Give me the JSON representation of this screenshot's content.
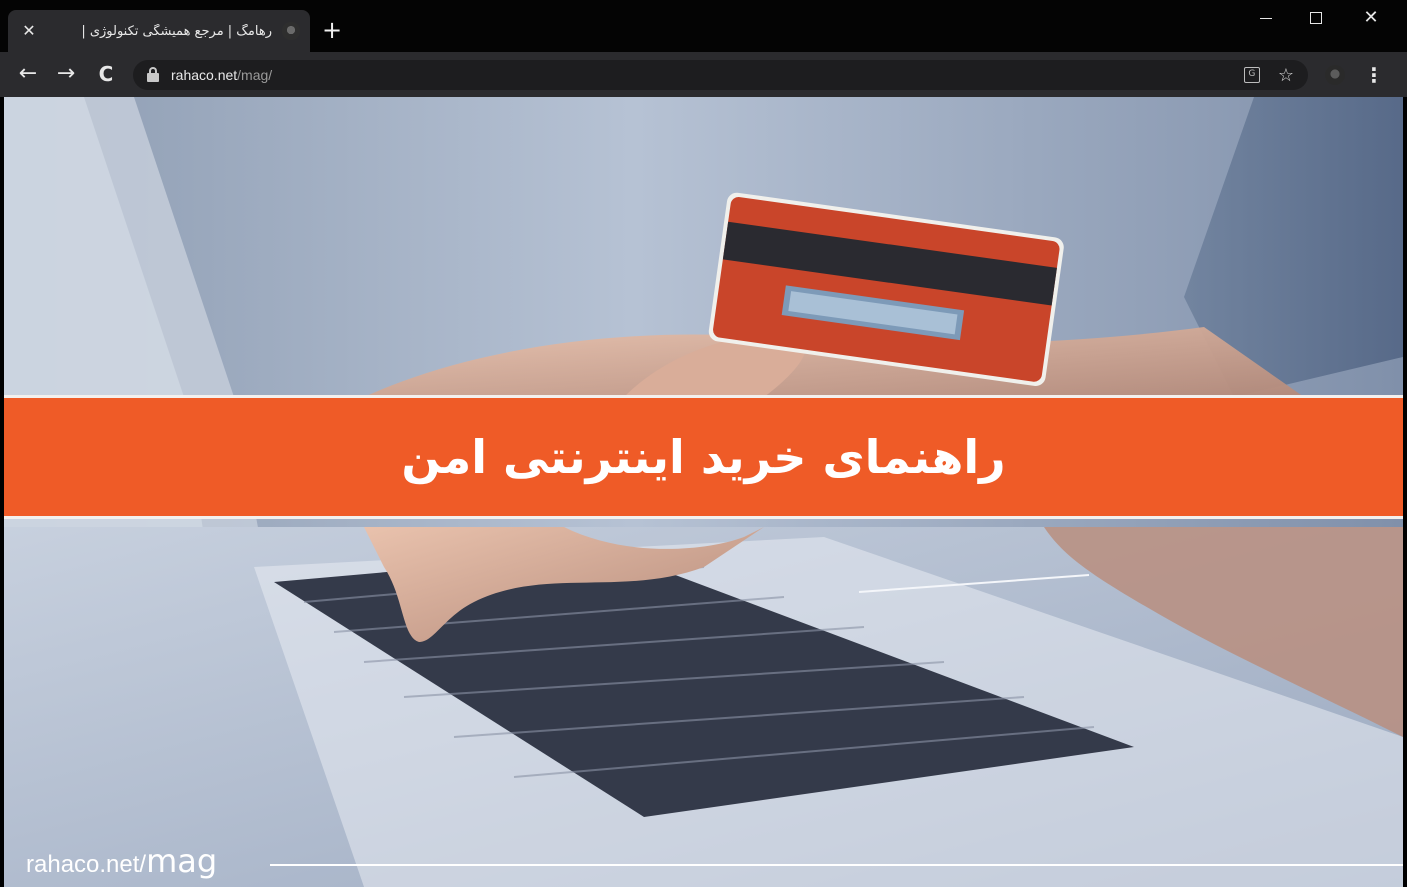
{
  "browser": {
    "tab": {
      "title": "رهامگ | مرجع همیشگی تکنولوژی |",
      "close_glyph": "✕"
    },
    "new_tab_glyph": "+",
    "window_controls": {
      "close_glyph": "✕"
    },
    "nav": {
      "back_glyph": "←",
      "forward_glyph": "→",
      "reload_glyph": "C"
    },
    "address": {
      "host": "rahaco.net",
      "path": "/mag/"
    },
    "icons": [
      "lock-icon",
      "translate-icon",
      "star-icon",
      "extension-icon",
      "menu-icon"
    ],
    "star_glyph": "☆",
    "menu_glyph": "⋮"
  },
  "page": {
    "banner_title": "راهنمای خرید اینترنتی امن",
    "footer": {
      "site": "rahaco.net/",
      "section": "mag"
    },
    "colors": {
      "banner": "#ef5b27",
      "card_red": "#c9452a",
      "card_stripe": "#2a2a30"
    }
  }
}
